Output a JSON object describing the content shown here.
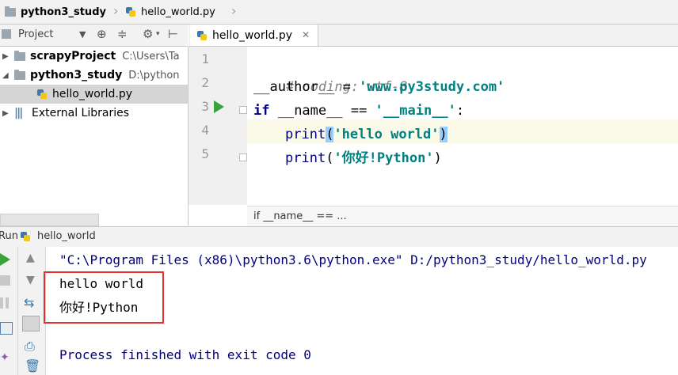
{
  "breadcrumb": {
    "project": "python3_study",
    "file": "hello_world.py"
  },
  "project_panel": {
    "title": "Project",
    "tree": [
      {
        "label": "scrapyProject",
        "path": "C:\\Users\\Ta",
        "bold": true
      },
      {
        "label": "python3_study",
        "path": "D:\\python",
        "bold": true
      },
      {
        "label": "hello_world.py",
        "path": "",
        "bold": false
      },
      {
        "label": "External Libraries",
        "path": "",
        "bold": false
      }
    ]
  },
  "editor": {
    "tab_label": "hello_world.py",
    "line_numbers": [
      "1",
      "2",
      "3",
      "4",
      "5"
    ],
    "code": {
      "l1": "# coding: utf-8",
      "l2_a": "__author__ = ",
      "l2_b": "'www.py3study.com'",
      "l3_kw": "if",
      "l3_a": " __name__ == ",
      "l3_b": "'__main__'",
      "l3_c": ":",
      "l4_fn": "print",
      "l4_open": "(",
      "l4_str": "'hello world'",
      "l4_close": ")",
      "l5_fn": "print",
      "l5_open": "(",
      "l5_str": "'你好!Python'",
      "l5_close": ")"
    },
    "status_breadcrumb": "if __name__ == ..."
  },
  "run": {
    "title": "Run",
    "config": "hello_world",
    "command": "\"C:\\Program Files (x86)\\python3.6\\python.exe\" D:/python3_study/hello_world.py",
    "output": [
      "hello world",
      "你好!Python"
    ],
    "exit_message": "Process finished with exit code 0"
  }
}
